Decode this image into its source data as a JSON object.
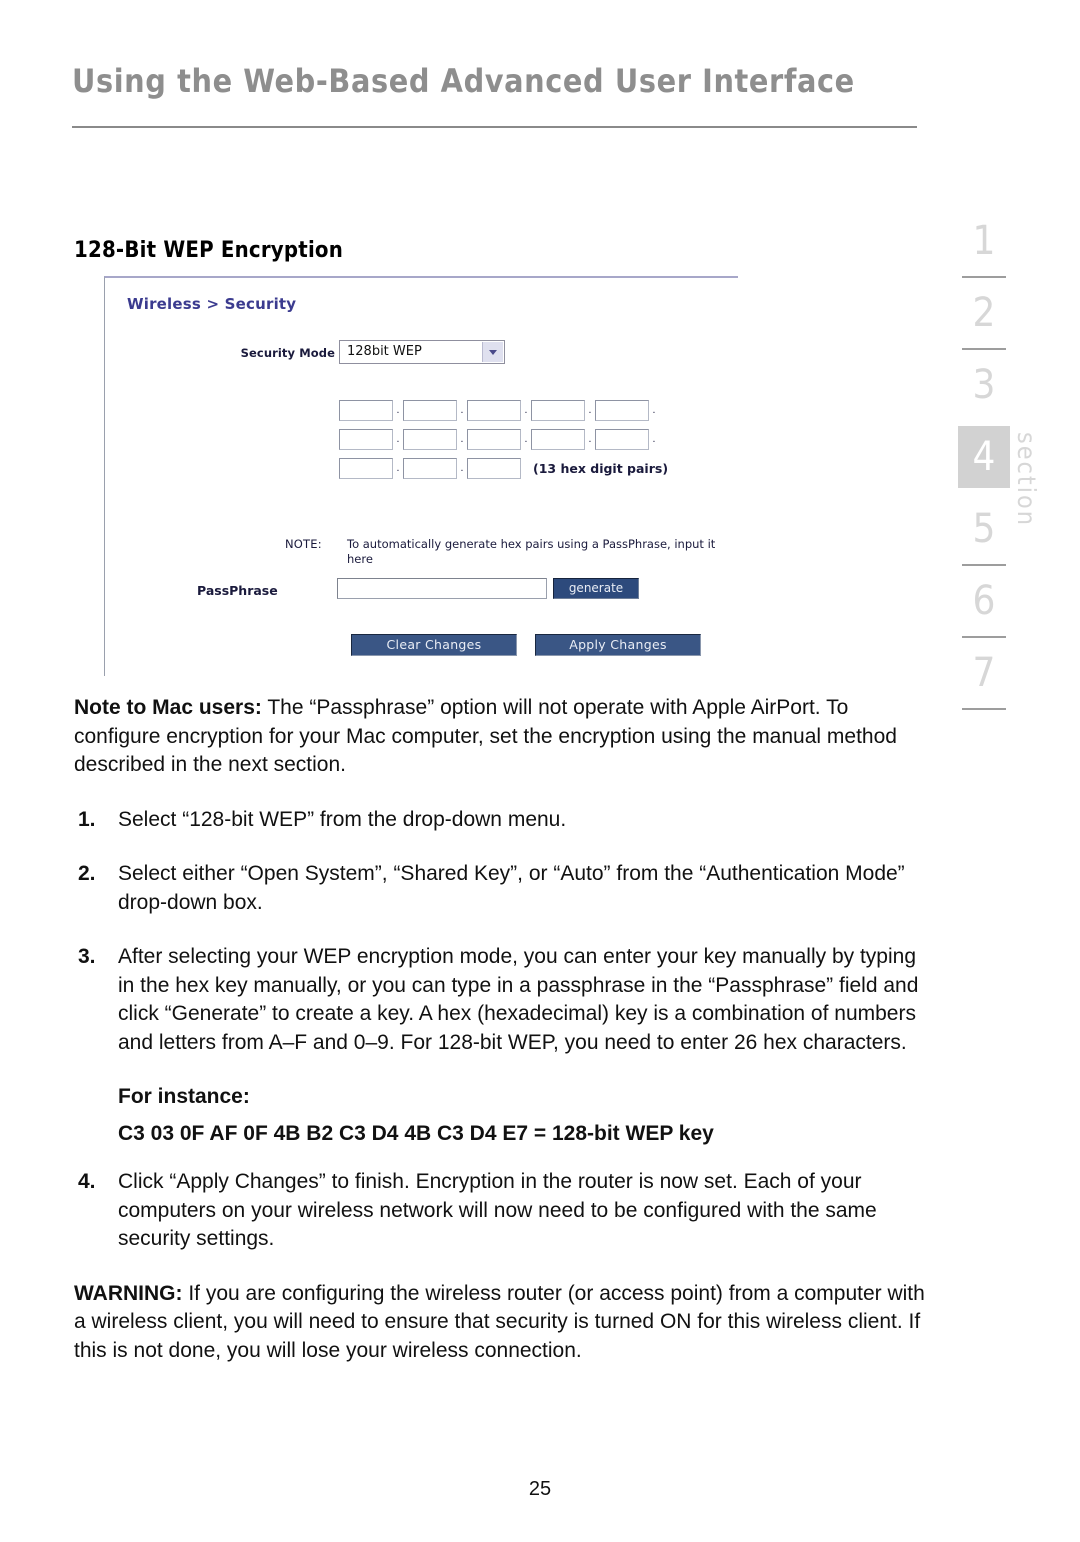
{
  "header": {
    "title": "Using the Web-Based Advanced User Interface"
  },
  "section_rail": {
    "word": "section",
    "active": "4",
    "items": [
      {
        "label": "1",
        "rule": true
      },
      {
        "label": "2",
        "rule": true
      },
      {
        "label": "3",
        "rule": false
      },
      {
        "label": "4",
        "rule": false
      },
      {
        "label": "5",
        "rule": true
      },
      {
        "label": "6",
        "rule": true
      },
      {
        "label": "7",
        "rule": true
      }
    ]
  },
  "sub_heading": "128-Bit WEP Encryption",
  "screenshot": {
    "breadcrumb": "Wireless > Security",
    "security_mode": {
      "label": "Security Mode",
      "value": "128bit WEP",
      "arrow_icon": "chevron-down-icon"
    },
    "hex_grid": {
      "separator": ".",
      "note": "(13 hex digit pairs)",
      "rows": [
        [
          "",
          "",
          "",
          "",
          ""
        ],
        [
          "",
          "",
          "",
          "",
          ""
        ],
        [
          "",
          "",
          ""
        ]
      ]
    },
    "note": {
      "label": "NOTE:",
      "text": "To automatically generate hex pairs using a PassPhrase, input it here"
    },
    "passphrase": {
      "label": "PassPhrase",
      "value": "",
      "placeholder": "",
      "generate_label": "generate"
    },
    "actions": {
      "clear_label": "Clear Changes",
      "apply_label": "Apply Changes"
    }
  },
  "body": {
    "mac_note_bold": "Note to Mac users:",
    "mac_note_text": " The “Passphrase” option will not operate with Apple AirPort. To configure encryption for your Mac computer, set the encryption using the manual method described in the next section.",
    "steps": [
      {
        "num": "1.",
        "text": "Select “128-bit WEP” from the drop-down menu."
      },
      {
        "num": "2.",
        "text": "Select either “Open System”, “Shared Key”, or “Auto” from the “Authentication Mode” drop-down box."
      },
      {
        "num": "3.",
        "text": "After selecting your WEP encryption mode, you can enter your key manually by typing in the hex key manually, or you can type in a passphrase in the “Passphrase” field and click “Generate” to create a key. A hex (hexadecimal) key is a combination of numbers and  letters from A–F and 0–9. For 128-bit WEP, you need to enter 26 hex characters."
      },
      {
        "num": "4.",
        "text": "Click “Apply Changes” to finish. Encryption in the router is now set. Each of your computers on your wireless network will now need to be configured with the same security settings."
      }
    ],
    "for_instance": "For instance:",
    "example_key": "C3 03 0F AF 0F 4B B2 C3 D4 4B C3 D4 E7 = 128-bit WEP key",
    "warning_bold": "WARNING:",
    "warning_text": " If you are configuring the wireless router (or access point) from a computer with a wireless client, you will need to ensure that security is turned ON for this wireless client. If this is not done, you will lose your wireless connection."
  },
  "page_number": "25"
}
